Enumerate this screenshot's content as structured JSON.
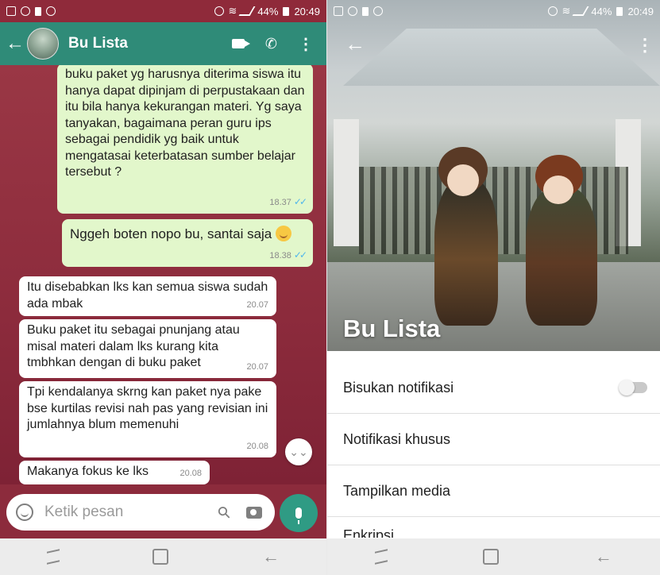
{
  "status": {
    "battery": "44%",
    "time": "20:49"
  },
  "chat": {
    "contact_name": "Bu Lista",
    "messages": [
      {
        "dir": "out",
        "text": "buku paket yg harusnya diterima siswa itu hanya dapat dipinjam di perpustakaan dan itu bila hanya kekurangan materi. Yg saya tanyakan, bagaimana peran guru ips sebagai pendidik yg baik untuk mengatasai keterbatasan sumber belajar tersebut ?",
        "time": "18.37"
      },
      {
        "dir": "out",
        "text": "Nggeh boten nopo bu, santai saja",
        "time": "18.38"
      },
      {
        "dir": "in",
        "text": "Itu disebabkan lks kan semua siswa sudah ada mbak",
        "time": "20.07"
      },
      {
        "dir": "in",
        "text": "Buku paket itu sebagai pnunjang atau misal materi dalam lks kurang kita tmbhkan dengan di buku paket",
        "time": "20.07"
      },
      {
        "dir": "in",
        "text": "Tpi kendalanya skrng kan paket nya pake bse kurtilas revisi nah pas yang revisian ini jumlahnya blum memenuhi",
        "time": "20.08"
      },
      {
        "dir": "in",
        "text": "Makanya fokus ke lks",
        "time": "20.08"
      }
    ],
    "input_placeholder": "Ketik pesan"
  },
  "profile": {
    "name": "Bu Lista",
    "settings": [
      "Bisukan notifikasi",
      "Notifikasi khusus",
      "Tampilkan media",
      "Enkripsi"
    ],
    "mute_enabled": false
  },
  "colors": {
    "header": "#2f8b78",
    "outgoing": "#e2f7cb",
    "incoming": "#ffffff",
    "chat_bg": "#8c2b3c"
  }
}
